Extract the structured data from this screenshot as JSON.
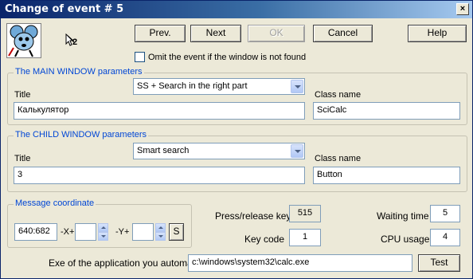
{
  "window": {
    "title": "Change of event # 5",
    "close_symbol": "×"
  },
  "toolbar": {
    "prev_label": "Prev.",
    "next_label": "Next",
    "ok_label": "OK",
    "cancel_label": "Cancel",
    "help_label": "Help",
    "small_icon_label": "2"
  },
  "omit_checkbox": {
    "label": "Omit the event if the window is not found",
    "checked": false
  },
  "main_window": {
    "group_label": "The MAIN WINDOW parameters",
    "search_mode": "SS + Search in the right part",
    "title_label": "Title",
    "title_value": "Калькулятор",
    "class_label": "Class name",
    "class_value": "SciCalc"
  },
  "child_window": {
    "group_label": "The CHILD WINDOW parameters",
    "search_mode": "Smart search",
    "title_label": "Title",
    "title_value": "3",
    "class_label": "Class name",
    "class_value": "Button"
  },
  "message_coordinate": {
    "group_label": "Message coordinate",
    "value": "640:682",
    "x_label": "-X+",
    "x_value": "",
    "y_label": "-Y+",
    "y_value": "",
    "s_button_label": "S"
  },
  "params": {
    "press_release_label": "Press/release key",
    "press_release_value": "515",
    "key_code_label": "Key code",
    "key_code_value": "1",
    "waiting_time_label": "Waiting time",
    "waiting_time_value": "5",
    "cpu_usage_label": "CPU usage",
    "cpu_usage_value": "4"
  },
  "exe": {
    "label": "Exe of the application you automate",
    "value": "c:\\windows\\system32\\calc.exe",
    "test_label": "Test"
  },
  "colors": {
    "titlebar_start": "#0a246a",
    "titlebar_end": "#a6caf0",
    "group_label": "#0046d5",
    "face": "#ece9d8"
  }
}
